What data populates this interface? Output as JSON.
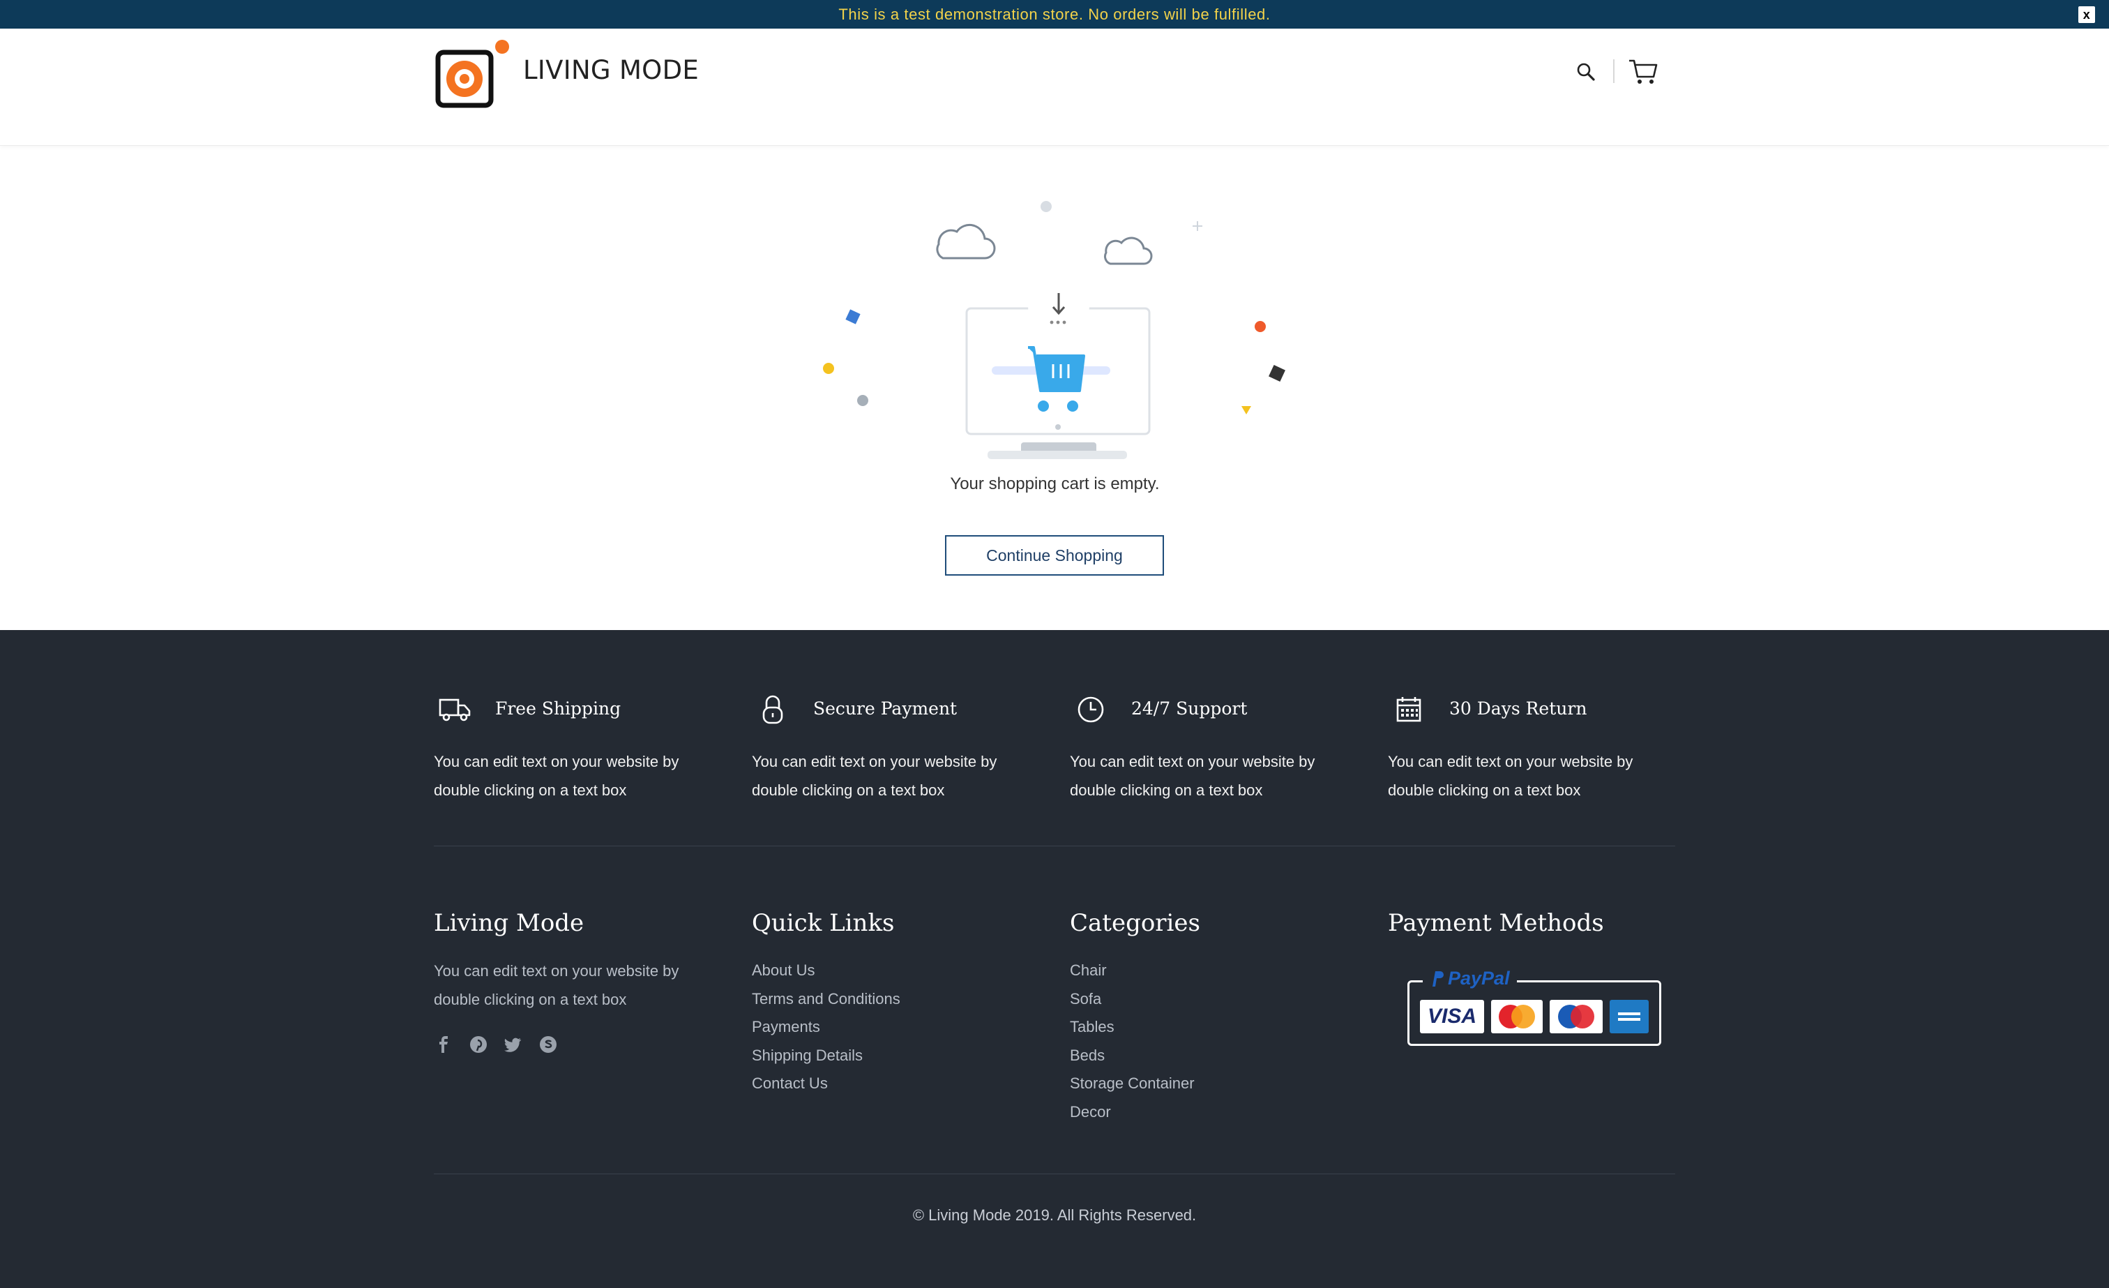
{
  "announcement": {
    "text": "This is a test demonstration store. No orders will be fulfilled.",
    "close_label": "x"
  },
  "header": {
    "brand": "LIVING MODE",
    "logo_icon": "camera-lens-logo",
    "search_icon": "search-icon",
    "cart_icon": "cart-icon",
    "accent_color": "#f47321"
  },
  "cart": {
    "empty_message": "Your shopping cart is empty.",
    "continue_label": "Continue Shopping"
  },
  "features": [
    {
      "icon": "truck-icon",
      "title": "Free Shipping",
      "text": "You can edit text on your website by double clicking on a text box"
    },
    {
      "icon": "lock-icon",
      "title": "Secure Payment",
      "text": "You can edit text on your website by double clicking on a text box"
    },
    {
      "icon": "clock-icon",
      "title": "24/7 Support",
      "text": "You can edit text on your website by double clicking on a text box"
    },
    {
      "icon": "calendar-icon",
      "title": "30 Days Return",
      "text": "You can edit text on your website by double clicking on a text box"
    }
  ],
  "footer": {
    "about": {
      "title": "Living Mode",
      "text": "You can edit text on your website by double clicking on a text box",
      "socials": [
        "facebook-icon",
        "pinterest-icon",
        "twitter-icon",
        "skype-icon"
      ]
    },
    "quick_links": {
      "title": "Quick Links",
      "items": [
        "About Us",
        "Terms and Conditions",
        "Payments",
        "Shipping Details",
        "Contact Us"
      ]
    },
    "categories": {
      "title": "Categories",
      "items": [
        "Chair",
        "Sofa",
        "Tables",
        "Beds",
        "Storage Container",
        "Decor"
      ]
    },
    "payment": {
      "title": "Payment Methods",
      "paypal_label": "PayPal",
      "cards": [
        "VISA",
        "MasterCard",
        "Maestro",
        "American Express"
      ]
    },
    "copyright": "© Living Mode 2019. All Rights Reserved.",
    "background": "#242a33"
  }
}
